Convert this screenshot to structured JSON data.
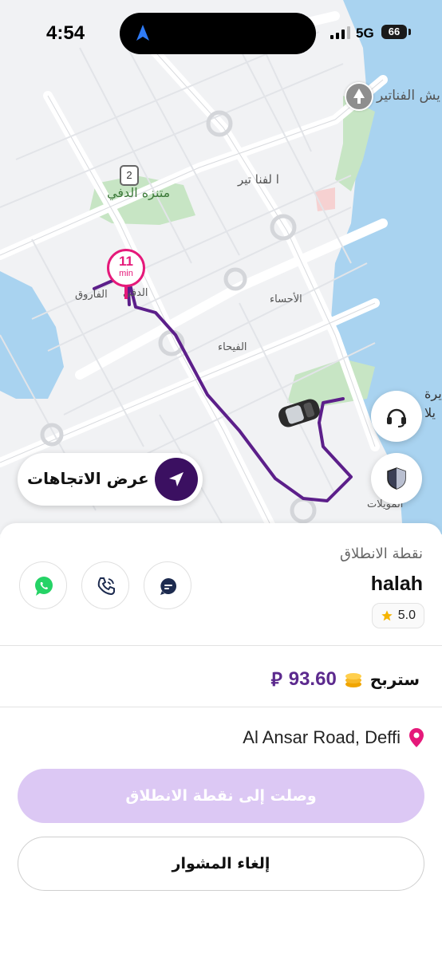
{
  "status_bar": {
    "time": "4:54",
    "network": "5G",
    "battery": "66"
  },
  "map": {
    "labels": {
      "fanateer": "يش الفناتير",
      "dafi_park": "متنزه الدفي",
      "fanateer_district": "ا لفنا تير",
      "farouq": "الفاروق",
      "dafi": "الدفي",
      "ahsa": "الأحساء",
      "fayha": "الفيحاء",
      "muwailat": "المويلات",
      "island_top": "يرة",
      "island_bottom": "يلا"
    },
    "road_number": "2",
    "eta": {
      "value": "11",
      "unit": "min"
    }
  },
  "controls": {
    "directions_label": "عرض الاتجاهات"
  },
  "trip": {
    "pickup_title": "نقطة الانطلاق",
    "rider_name": "halah",
    "rating": "5.0",
    "earnings_label": "ستربح",
    "earnings_amount": "93.60",
    "currency_symbol": "⃁",
    "address": "Al Ansar Road, Deffi",
    "arrived_button": "وصلت إلى نقطة الانطلاق",
    "cancel_button": "إلغاء المشوار"
  },
  "colors": {
    "route": "#5c1f8a",
    "eta_pin": "#e5197a",
    "arrived_button_bg": "#dcc8f4",
    "directions_icon_bg": "#3b1061",
    "whatsapp": "#25d366",
    "water": "#a9d3f0",
    "park": "#c7e5c4"
  },
  "icons": [
    "location-arrow-icon",
    "signal-icon",
    "headset-icon",
    "shield-icon",
    "navigation-arrow-icon",
    "whatsapp-icon",
    "phone-icon",
    "chat-icon",
    "star-icon",
    "coins-icon",
    "location-pin-icon",
    "car-icon",
    "tree-icon"
  ]
}
